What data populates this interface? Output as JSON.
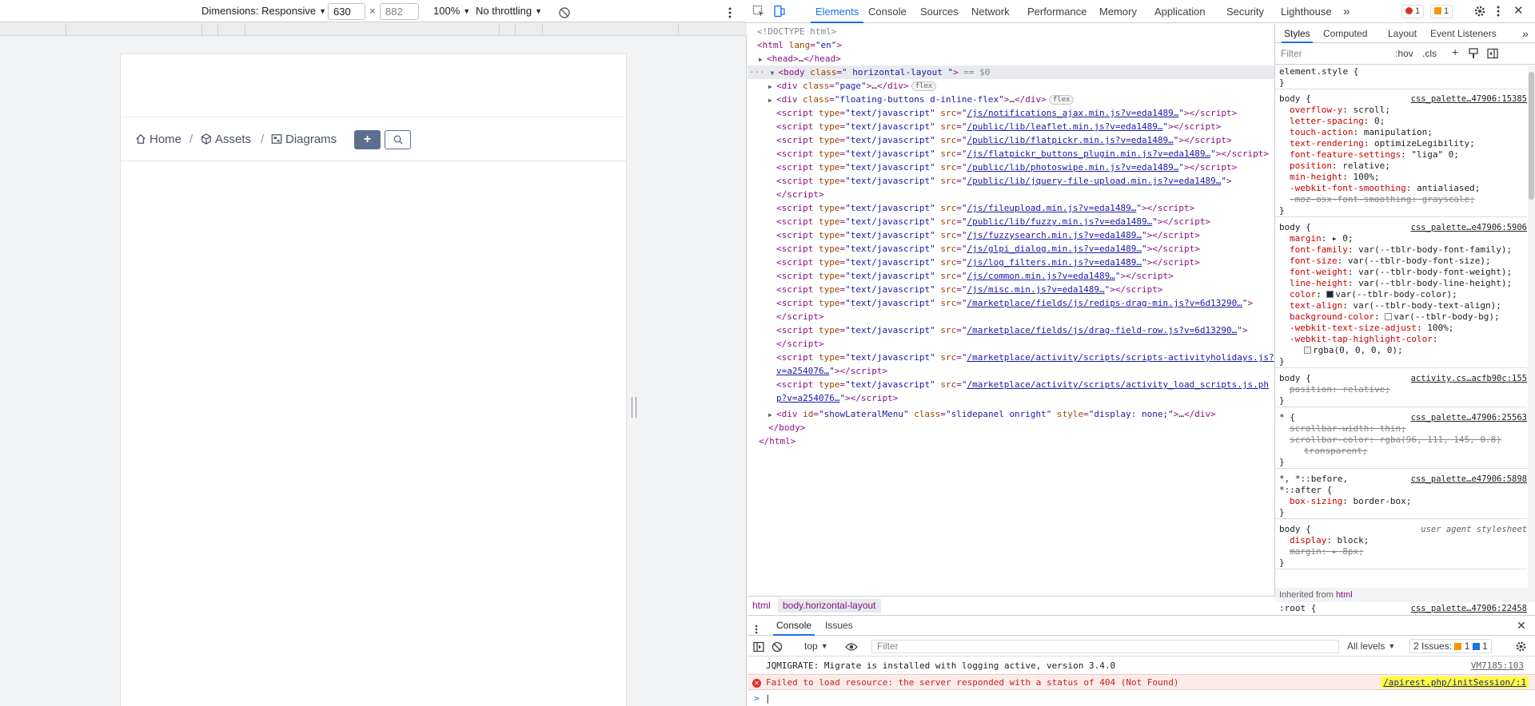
{
  "device_toolbar": {
    "dimensions_label": "Dimensions: Responsive",
    "width_value": "630",
    "times": "×",
    "height_value": "882",
    "zoom": "100%",
    "throttling": "No throttling"
  },
  "page": {
    "breadcrumbs": [
      {
        "label": "Home"
      },
      {
        "label": "Assets"
      },
      {
        "label": "Diagrams"
      }
    ],
    "separator": "/",
    "add_label": "+"
  },
  "devtools": {
    "tabs": [
      "Elements",
      "Console",
      "Sources",
      "Network",
      "Performance",
      "Memory",
      "Application",
      "Security",
      "Lighthouse"
    ],
    "more_tabs": "»",
    "error_count": "1",
    "warning_count": "1"
  },
  "dom": {
    "doctype": "<!DOCTYPE html>",
    "html_open_tag": "html",
    "html_lang_attr": "lang",
    "html_lang_val": "\"en\"",
    "head": "head",
    "body_class": "\" horizontal-layout \"",
    "body_marker": "== $0",
    "div_page_class": "\"page\"",
    "div_floating_class": "\"floating-buttons d-inline-flex\"",
    "flex_pill": "flex",
    "scripts": [
      "/js/notifications_ajax.min.js?v=eda1489…",
      "/public/lib/leaflet.min.js?v=eda1489…",
      "/public/lib/flatpickr.min.js?v=eda1489…",
      "/js/flatpickr_buttons_plugin.min.js?v=eda1489…",
      "/public/lib/photoswipe.min.js?v=eda1489…",
      "/public/lib/jquery-file-upload.min.js?v=eda1489…",
      "/js/fileupload.min.js?v=eda1489…",
      "/public/lib/fuzzy.min.js?v=eda1489…",
      "/js/fuzzysearch.min.js?v=eda1489…",
      "/js/glpi_dialog.min.js?v=eda1489…",
      "/js/log_filters.min.js?v=eda1489…",
      "/js/common.min.js?v=eda1489…",
      "/js/misc.min.js?v=eda1489…",
      "/marketplace/fields/js/redips-drag-min.js?v=6d13290…",
      "/marketplace/fields/js/drag-field-row.js?v=6d13290…",
      "/marketplace/activity/scripts/scripts-activityholidays.js?",
      "v=a254076…",
      "/marketplace/activity/scripts/activity_load_scripts.js.ph",
      "p?v=a254076…"
    ],
    "script_type": "\"text/javascript\"",
    "lateral_id": "\"showLateralMenu\"",
    "lateral_class": "\"slidepanel onright\"",
    "lateral_style": "\"display: none;\"",
    "ellipsis": "…"
  },
  "dom_breadcrumbs": [
    "html",
    "body.horizontal-layout"
  ],
  "styles": {
    "tabs": [
      "Styles",
      "Computed",
      "Layout",
      "Event Listeners"
    ],
    "more": "»",
    "filter_placeholder": "Filter",
    "hov": ":hov",
    "cls": ".cls",
    "plus": "+",
    "element_style": "element.style {",
    "rules": [
      {
        "selector": "body {",
        "source": "css_palette…47906:15385",
        "props": [
          {
            "n": "overflow-y",
            "v": "scroll;"
          },
          {
            "n": "letter-spacing",
            "v": "0;"
          },
          {
            "n": "touch-action",
            "v": "manipulation;"
          },
          {
            "n": "text-rendering",
            "v": "optimizeLegibility;"
          },
          {
            "n": "font-feature-settings",
            "v": "\"liga\" 0;"
          },
          {
            "n": "position",
            "v": "relative;"
          },
          {
            "n": "min-height",
            "v": "100%;"
          },
          {
            "n": "-webkit-font-smoothing",
            "v": "antialiased;"
          },
          {
            "n": "-moz-osx-font-smoothing",
            "v": "grayscale;",
            "strike": true
          }
        ]
      },
      {
        "selector": "body {",
        "source": "css_palette…e47906:5906",
        "props": [
          {
            "n": "margin",
            "v": "▸ 0;"
          },
          {
            "n": "font-family",
            "v": "var(--tblr-body-font-family);"
          },
          {
            "n": "font-size",
            "v": "var(--tblr-body-font-size);"
          },
          {
            "n": "font-weight",
            "v": "var(--tblr-body-font-weight);"
          },
          {
            "n": "line-height",
            "v": "var(--tblr-body-line-height);"
          },
          {
            "n": "color",
            "v": "var(--tblr-body-color);",
            "swatch": "#1e293b"
          },
          {
            "n": "text-align",
            "v": "var(--tblr-body-text-align);"
          },
          {
            "n": "background-color",
            "v": "var(--tblr-body-bg);",
            "swatch": "#ffffff"
          },
          {
            "n": "-webkit-text-size-adjust",
            "v": "100%;"
          },
          {
            "n": "-webkit-tap-highlight-color",
            "v": ""
          },
          {
            "n": "",
            "v": "rgba(0, 0, 0, 0);",
            "swatch": "#f0f0f0",
            "cont": true
          }
        ]
      },
      {
        "selector": "body {",
        "source": "activity.cs…acfb90c:155",
        "props": [
          {
            "n": "position",
            "v": "relative;",
            "strike": true
          }
        ]
      },
      {
        "selector": "* {",
        "source": "css_palette…47906:25563",
        "props": [
          {
            "n": "scrollbar-width",
            "v": "thin;",
            "strike": true
          },
          {
            "n": "scrollbar-color",
            "v": "rgba(96, 111, 145, 0.8)",
            "strike": true
          },
          {
            "n": "",
            "v": "transparent;",
            "strike": true,
            "cont": true
          }
        ]
      },
      {
        "selector": "*, *::before,",
        "selector2": "*::after {",
        "source": "css_palette…e47906:5898",
        "props": [
          {
            "n": "box-sizing",
            "v": "border-box;"
          }
        ]
      },
      {
        "selector": "body {",
        "source": "user agent stylesheet",
        "ua": true,
        "props": [
          {
            "n": "display",
            "v": "block;"
          },
          {
            "n": "margin",
            "v": "▸ 8px;",
            "strike": true
          }
        ]
      }
    ],
    "inherited_label": "Inherited from",
    "inherited_tag": "html",
    "root_selector": ":root {",
    "root_source": "css_palette…47906:22458"
  },
  "console": {
    "tabs": [
      "Console",
      "Issues"
    ],
    "context": "top",
    "filter_placeholder": "Filter",
    "levels": "All levels",
    "issues_label": "2 Issues:",
    "issues_warn": "1",
    "issues_info": "1",
    "messages": [
      {
        "text": "JQMIGRATE: Migrate is installed with logging active, version 3.4.0",
        "source": "VM7185:103",
        "level": "info"
      },
      {
        "text": "Failed to load resource: the server responded with a status of 404 (Not Found)",
        "source": "/apirest.php/initSession/:1",
        "level": "error"
      }
    ],
    "prompt": ">"
  }
}
